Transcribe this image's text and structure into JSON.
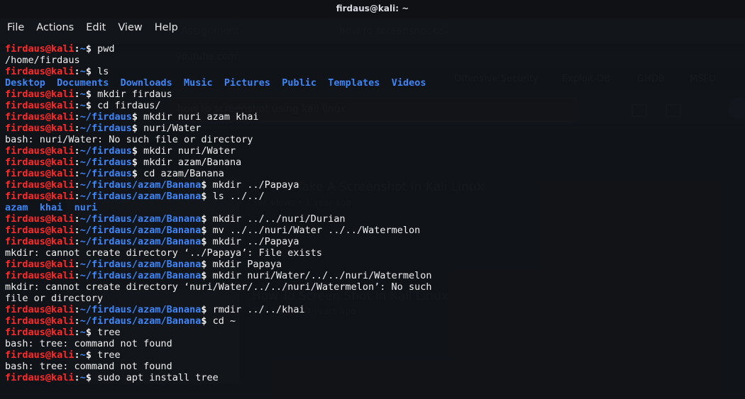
{
  "window": {
    "title": "firdaus@kali: ~"
  },
  "menu": [
    "File",
    "Actions",
    "Edit",
    "View",
    "Help"
  ],
  "prompt_user": "firdaus@kali",
  "terminal_lines": [
    {
      "type": "prompt",
      "path": "~",
      "command": "pwd"
    },
    {
      "type": "output",
      "text": "/home/firdaus"
    },
    {
      "type": "prompt",
      "path": "~",
      "command": "ls"
    },
    {
      "type": "dirs",
      "items": [
        "Desktop",
        "Documents",
        "Downloads",
        "Music",
        "Pictures",
        "Public",
        "Templates",
        "Videos"
      ]
    },
    {
      "type": "prompt",
      "path": "~",
      "command": "mkdir firdaus"
    },
    {
      "type": "prompt",
      "path": "~",
      "command": "cd firdaus/"
    },
    {
      "type": "prompt",
      "path": "~/firdaus",
      "command": "mkdir nuri azam khai"
    },
    {
      "type": "prompt",
      "path": "~/firdaus",
      "command": "nuri/Water"
    },
    {
      "type": "output",
      "text": "bash: nuri/Water: No such file or directory"
    },
    {
      "type": "prompt",
      "path": "~/firdaus",
      "command": "mkdir nuri/Water"
    },
    {
      "type": "prompt",
      "path": "~/firdaus",
      "command": "mkdir azam/Banana"
    },
    {
      "type": "prompt",
      "path": "~/firdaus",
      "command": "cd azam/Banana"
    },
    {
      "type": "prompt",
      "path": "~/firdaus/azam/Banana",
      "command": "mkdir ../Papaya"
    },
    {
      "type": "prompt",
      "path": "~/firdaus/azam/Banana",
      "command": "ls ../../"
    },
    {
      "type": "dirs",
      "items": [
        "azam",
        "khai",
        "nuri"
      ]
    },
    {
      "type": "prompt",
      "path": "~/firdaus/azam/Banana",
      "command": "mkdir ../../nuri/Durian"
    },
    {
      "type": "prompt",
      "path": "~/firdaus/azam/Banana",
      "command": "mv ../../nuri/Water ../../Watermelon"
    },
    {
      "type": "prompt",
      "path": "~/firdaus/azam/Banana",
      "command": "mkdir ../Papaya"
    },
    {
      "type": "output",
      "text": "mkdir: cannot create directory ‘../Papaya’: File exists"
    },
    {
      "type": "prompt",
      "path": "~/firdaus/azam/Banana",
      "command": "mkdir Papaya"
    },
    {
      "type": "prompt",
      "path": "~/firdaus/azam/Banana",
      "command": "mkdir nuri/Water/../../nuri/Watermelon"
    },
    {
      "type": "output",
      "text": "mkdir: cannot create directory ‘nuri/Water/../../nuri/Watermelon’: No such"
    },
    {
      "type": "output",
      "text": "file or directory"
    },
    {
      "type": "prompt",
      "path": "~/firdaus/azam/Banana",
      "command": "rmdir ../../khai"
    },
    {
      "type": "prompt",
      "path": "~/firdaus/azam/Banana",
      "command": "cd ~"
    },
    {
      "type": "prompt",
      "path": "~",
      "command": "tree"
    },
    {
      "type": "output",
      "text": "bash: tree: command not found"
    },
    {
      "type": "prompt",
      "path": "~",
      "command": "tree"
    },
    {
      "type": "output",
      "text": "bash: tree: command not found"
    },
    {
      "type": "prompt",
      "path": "~",
      "command": "sudo apt install tree"
    }
  ],
  "background_browser": {
    "window_title": "how to screenshot using kali linux - YouTube — Mozilla Firefox",
    "tabs": [
      "Assignment",
      "how to screenshot usi"
    ],
    "url": "youtube.com",
    "bookmarks": [
      "Offensive Security",
      "Exploit-DB",
      "GHDB",
      "MSFU"
    ],
    "search_text": "how to screenshot using kali linux",
    "videos": [
      {
        "title": "Take A Screenshot In Kali Linux",
        "meta": "32K views • 1 year ago"
      },
      {
        "title": "How To Screen Shot In Kali Linux",
        "meta": "22K views • 4 years ago"
      }
    ]
  }
}
